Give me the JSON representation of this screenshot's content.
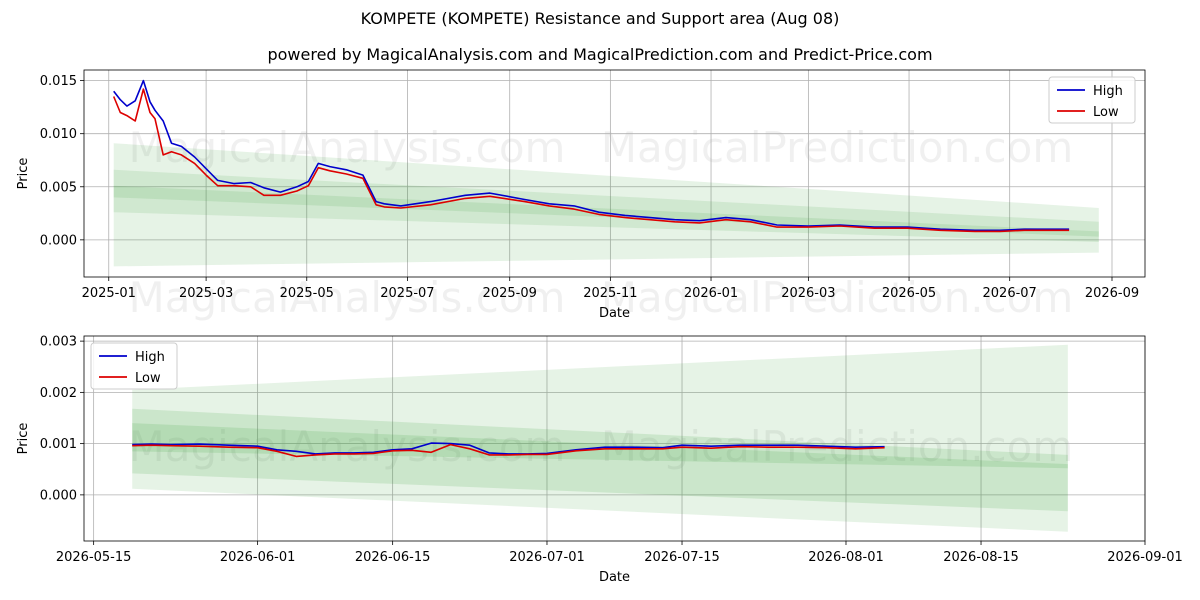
{
  "header": {
    "title": "KOMPETE (KOMPETE) Resistance and Support area (Aug 08)",
    "subtitle": "powered by MagicalAnalysis.com and MagicalPrediction.com and Predict-Price.com"
  },
  "watermarks": [
    "MagicalAnalysis.com",
    "MagicalPrediction.com"
  ],
  "colors": {
    "high": "#0000cc",
    "low": "#dd0000",
    "band": "#2e9b2e",
    "grid": "#b0b0b0"
  },
  "chart_data": [
    {
      "type": "line",
      "xlabel": "Date",
      "ylabel": "Price",
      "xlim": [
        "2024-12-17",
        "2026-09-21"
      ],
      "ylim": [
        -0.0035,
        0.016
      ],
      "xticks": [
        "2025-01",
        "2025-03",
        "2025-05",
        "2025-07",
        "2025-09",
        "2025-11",
        "2026-01",
        "2026-03",
        "2026-05",
        "2026-07",
        "2026-09"
      ],
      "xtick_dates": [
        "2025-01-01",
        "2025-03-01",
        "2025-05-01",
        "2025-07-01",
        "2025-09-01",
        "2025-11-01",
        "2026-01-01",
        "2026-03-01",
        "2026-05-01",
        "2026-07-01",
        "2026-09-01"
      ],
      "yticks": [
        "0.000",
        "0.005",
        "0.010",
        "0.015"
      ],
      "ytick_values": [
        0,
        0.005,
        0.01,
        0.015
      ],
      "legend": "top-right",
      "grid": true,
      "series": [
        {
          "name": "High",
          "color": "#0000cc",
          "x": [
            "2025-01-04",
            "2025-01-08",
            "2025-01-12",
            "2025-01-17",
            "2025-01-22",
            "2025-01-26",
            "2025-01-29",
            "2025-02-03",
            "2025-02-08",
            "2025-02-14",
            "2025-02-22",
            "2025-03-01",
            "2025-03-08",
            "2025-03-18",
            "2025-03-28",
            "2025-04-05",
            "2025-04-15",
            "2025-04-25",
            "2025-05-02",
            "2025-05-08",
            "2025-05-15",
            "2025-05-25",
            "2025-06-04",
            "2025-06-12",
            "2025-06-17",
            "2025-06-27",
            "2025-07-15",
            "2025-08-05",
            "2025-08-20",
            "2025-09-10",
            "2025-09-25",
            "2025-10-10",
            "2025-10-25",
            "2025-11-10",
            "2025-11-25",
            "2025-12-10",
            "2025-12-25",
            "2026-01-10",
            "2026-01-25",
            "2026-02-10",
            "2026-03-01",
            "2026-03-20",
            "2026-04-10",
            "2026-04-30",
            "2026-05-20",
            "2026-06-10",
            "2026-06-25",
            "2026-07-10",
            "2026-07-25",
            "2026-08-06"
          ],
          "y": [
            0.014,
            0.0132,
            0.0126,
            0.0131,
            0.015,
            0.013,
            0.0122,
            0.0112,
            0.0091,
            0.0088,
            0.0078,
            0.0067,
            0.0056,
            0.0053,
            0.0054,
            0.0049,
            0.0045,
            0.005,
            0.0055,
            0.0072,
            0.0069,
            0.0066,
            0.0061,
            0.0036,
            0.0034,
            0.0032,
            0.0036,
            0.0042,
            0.0044,
            0.0038,
            0.0034,
            0.0032,
            0.0026,
            0.0023,
            0.0021,
            0.0019,
            0.0018,
            0.0021,
            0.0019,
            0.0014,
            0.0013,
            0.0014,
            0.0012,
            0.0012,
            0.001,
            0.0009,
            0.0009,
            0.001,
            0.001,
            0.001
          ]
        },
        {
          "name": "Low",
          "color": "#dd0000",
          "x": [
            "2025-01-04",
            "2025-01-08",
            "2025-01-12",
            "2025-01-17",
            "2025-01-22",
            "2025-01-26",
            "2025-01-29",
            "2025-02-03",
            "2025-02-08",
            "2025-02-14",
            "2025-02-22",
            "2025-03-01",
            "2025-03-08",
            "2025-03-18",
            "2025-03-28",
            "2025-04-05",
            "2025-04-15",
            "2025-04-25",
            "2025-05-02",
            "2025-05-08",
            "2025-05-15",
            "2025-05-25",
            "2025-06-04",
            "2025-06-12",
            "2025-06-17",
            "2025-06-27",
            "2025-07-15",
            "2025-08-05",
            "2025-08-20",
            "2025-09-10",
            "2025-09-25",
            "2025-10-10",
            "2025-10-25",
            "2025-11-10",
            "2025-11-25",
            "2025-12-10",
            "2025-12-25",
            "2026-01-10",
            "2026-01-25",
            "2026-02-10",
            "2026-03-01",
            "2026-03-20",
            "2026-04-10",
            "2026-04-30",
            "2026-05-20",
            "2026-06-10",
            "2026-06-25",
            "2026-07-10",
            "2026-07-25",
            "2026-08-06"
          ],
          "y": [
            0.0135,
            0.012,
            0.0117,
            0.0112,
            0.0142,
            0.012,
            0.0114,
            0.008,
            0.0083,
            0.008,
            0.0072,
            0.0061,
            0.0051,
            0.0051,
            0.005,
            0.0042,
            0.0042,
            0.0046,
            0.0051,
            0.0068,
            0.0065,
            0.0062,
            0.0058,
            0.0033,
            0.0031,
            0.003,
            0.0033,
            0.0039,
            0.0041,
            0.0036,
            0.0032,
            0.0029,
            0.0024,
            0.0021,
            0.0019,
            0.0017,
            0.0016,
            0.0019,
            0.0017,
            0.0012,
            0.0012,
            0.0013,
            0.0011,
            0.0011,
            0.0009,
            0.0008,
            0.0008,
            0.0009,
            0.0009,
            0.0009
          ]
        }
      ],
      "bands": [
        {
          "x": [
            "2025-01-04",
            "2026-08-24"
          ],
          "upper": [
            0.0091,
            0.003
          ],
          "lower": [
            -0.0025,
            -0.0012
          ],
          "opacity": 0.12
        },
        {
          "x": [
            "2025-01-04",
            "2026-08-24"
          ],
          "upper": [
            0.0066,
            0.0017
          ],
          "lower": [
            0.0026,
            -0.0002
          ],
          "opacity": 0.12
        },
        {
          "x": [
            "2025-01-04",
            "2026-08-24"
          ],
          "upper": [
            0.0051,
            0.0008
          ],
          "lower": [
            0.004,
            0.0003
          ],
          "opacity": 0.12
        }
      ]
    },
    {
      "type": "line",
      "xlabel": "Date",
      "ylabel": "Price",
      "xlim": [
        "2026-05-14",
        "2026-09-01"
      ],
      "ylim": [
        -0.0009,
        0.0031
      ],
      "xticks": [
        "2026-05-15",
        "2026-06-01",
        "2026-06-15",
        "2026-07-01",
        "2026-07-15",
        "2026-08-01",
        "2026-08-15",
        "2026-09-01"
      ],
      "xtick_dates": [
        "2026-05-15",
        "2026-06-01",
        "2026-06-15",
        "2026-07-01",
        "2026-07-15",
        "2026-08-01",
        "2026-08-15",
        "2026-09-01"
      ],
      "yticks": [
        "0.000",
        "0.001",
        "0.002",
        "0.003"
      ],
      "ytick_values": [
        0,
        0.001,
        0.002,
        0.003
      ],
      "legend": "top-left",
      "grid": true,
      "series": [
        {
          "name": "High",
          "color": "#0000cc",
          "x": [
            "2026-05-19",
            "2026-05-21",
            "2026-05-23",
            "2026-05-26",
            "2026-05-29",
            "2026-06-01",
            "2026-06-03",
            "2026-06-05",
            "2026-06-07",
            "2026-06-09",
            "2026-06-11",
            "2026-06-13",
            "2026-06-15",
            "2026-06-17",
            "2026-06-19",
            "2026-06-21",
            "2026-06-23",
            "2026-06-25",
            "2026-06-27",
            "2026-06-29",
            "2026-07-01",
            "2026-07-04",
            "2026-07-07",
            "2026-07-10",
            "2026-07-13",
            "2026-07-15",
            "2026-07-18",
            "2026-07-21",
            "2026-07-24",
            "2026-07-27",
            "2026-07-30",
            "2026-08-02",
            "2026-08-05"
          ],
          "y": [
            0.00098,
            0.00099,
            0.00098,
            0.00099,
            0.00097,
            0.00095,
            0.00088,
            0.00085,
            0.0008,
            0.00082,
            0.00082,
            0.00083,
            0.00088,
            0.0009,
            0.00101,
            0.001,
            0.00097,
            0.00082,
            0.0008,
            0.0008,
            0.00081,
            0.00088,
            0.00093,
            0.00093,
            0.00092,
            0.00097,
            0.00095,
            0.00097,
            0.00097,
            0.00097,
            0.00095,
            0.00093,
            0.00094
          ]
        },
        {
          "name": "Low",
          "color": "#dd0000",
          "x": [
            "2026-05-19",
            "2026-05-21",
            "2026-05-23",
            "2026-05-26",
            "2026-05-29",
            "2026-06-01",
            "2026-06-03",
            "2026-06-05",
            "2026-06-07",
            "2026-06-09",
            "2026-06-11",
            "2026-06-13",
            "2026-06-15",
            "2026-06-17",
            "2026-06-19",
            "2026-06-21",
            "2026-06-23",
            "2026-06-25",
            "2026-06-27",
            "2026-06-29",
            "2026-07-01",
            "2026-07-04",
            "2026-07-07",
            "2026-07-10",
            "2026-07-13",
            "2026-07-15",
            "2026-07-18",
            "2026-07-21",
            "2026-07-24",
            "2026-07-27",
            "2026-07-30",
            "2026-08-02",
            "2026-08-05"
          ],
          "y": [
            0.00096,
            0.00097,
            0.00096,
            0.00095,
            0.00093,
            0.00092,
            0.00085,
            0.00075,
            0.00078,
            0.0008,
            0.0008,
            0.00081,
            0.00086,
            0.00087,
            0.00083,
            0.00098,
            0.0009,
            0.00078,
            0.00078,
            0.00079,
            0.00079,
            0.00086,
            0.0009,
            0.0009,
            0.0009,
            0.00093,
            0.00091,
            0.00094,
            0.00093,
            0.00093,
            0.00092,
            0.0009,
            0.00092
          ]
        }
      ],
      "bands": [
        {
          "x": [
            "2026-05-19",
            "2026-08-24"
          ],
          "upper": [
            0.00205,
            0.00293
          ],
          "lower": [
            0.00012,
            -0.00072
          ],
          "opacity": 0.12
        },
        {
          "x": [
            "2026-05-19",
            "2026-08-24"
          ],
          "upper": [
            0.00168,
            0.00078
          ],
          "lower": [
            0.00042,
            -0.00032
          ],
          "opacity": 0.14
        },
        {
          "x": [
            "2026-05-19",
            "2026-08-24"
          ],
          "upper": [
            0.0014,
            0.0006
          ],
          "lower": [
            0.00085,
            0.00052
          ],
          "opacity": 0.14
        }
      ]
    }
  ]
}
